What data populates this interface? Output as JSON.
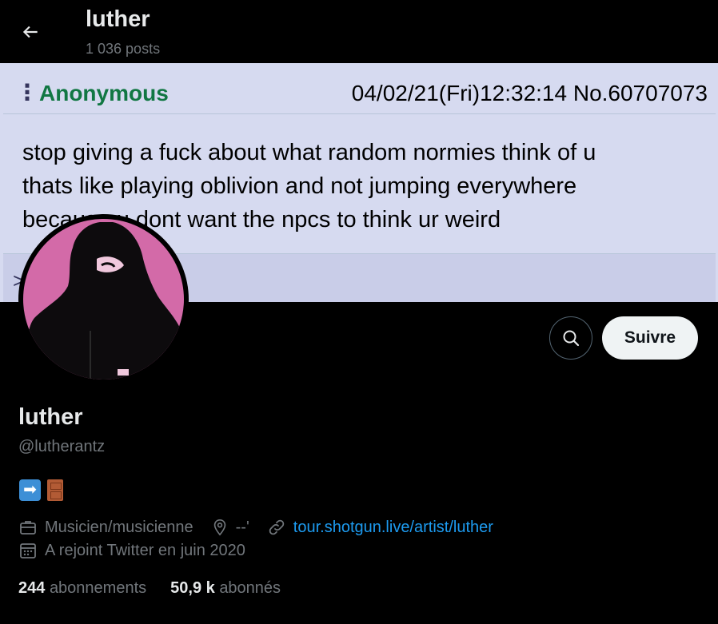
{
  "header": {
    "name": "luther",
    "posts": "1 036 posts"
  },
  "banner": {
    "author": "Anonymous",
    "meta": "04/02/21(Fri)12:32:14 No.60707073",
    "lines": [
      "stop giving a fuck about what random normies think of u",
      "thats like playing oblivion and not jumping everywhere",
      "because u dont want the npcs to think ur weird"
    ],
    "footer_mark": ">"
  },
  "actions": {
    "follow": "Suivre"
  },
  "profile": {
    "display_name": "luther",
    "handle": "@lutherantz",
    "bio_emojis": [
      "right-arrow-emoji",
      "door-emoji"
    ],
    "category": "Musicien/musicienne",
    "location": "--'",
    "website": "tour.shotgun.live/artist/luther",
    "joined": "A rejoint Twitter en juin 2020"
  },
  "stats": {
    "following_count": "244",
    "following_label": "abonnements",
    "followers_count": "50,9 k",
    "followers_label": "abonnés"
  },
  "colors": {
    "background": "#000000",
    "link": "#1d9bf0",
    "muted": "#71767b",
    "avatar_bg": "#d36aa8",
    "banner_bg": "#d6daf0",
    "anon_green": "#117743"
  }
}
